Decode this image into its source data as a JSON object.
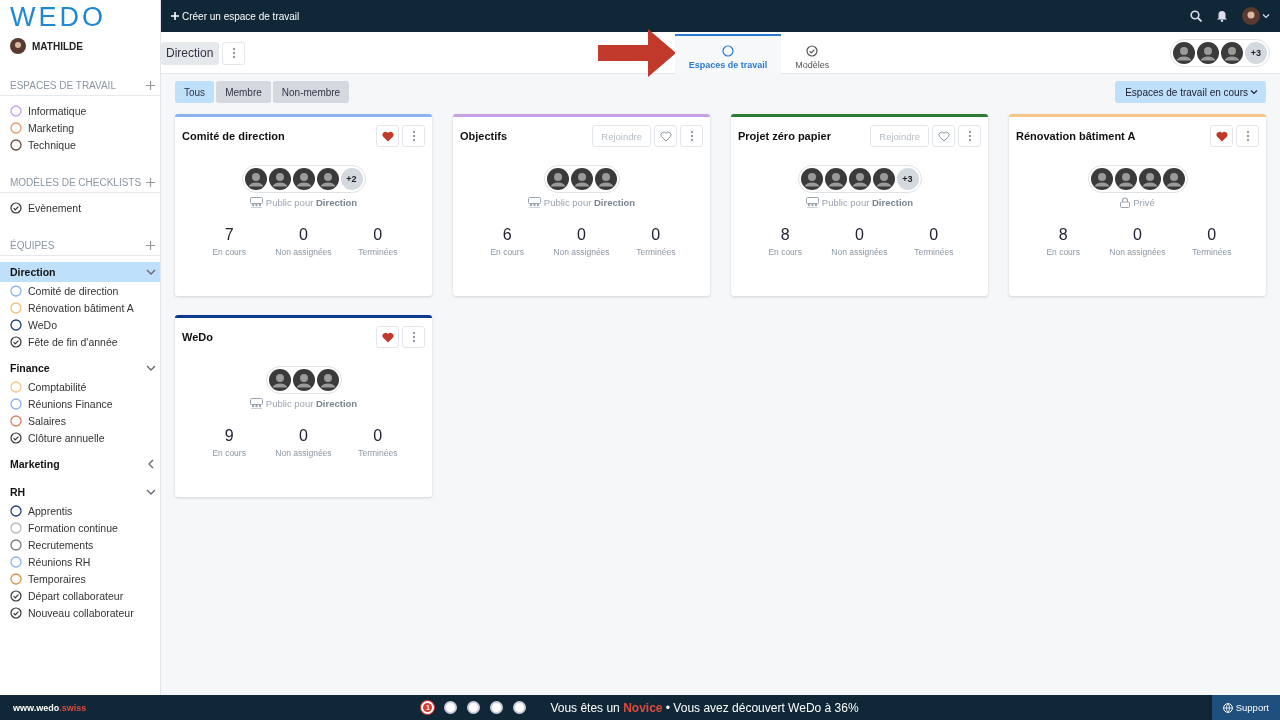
{
  "logo": "WEDO",
  "user": {
    "name": "MATHILDE"
  },
  "sidebar": {
    "sections": [
      {
        "title": "ESPACES DE TRAVAIL",
        "items": [
          {
            "label": "Informatique",
            "kind": "circle",
            "color": "#c9a0e6"
          },
          {
            "label": "Marketing",
            "kind": "circle",
            "color": "#e39a6e"
          },
          {
            "label": "Technique",
            "kind": "circle",
            "color": "#6b4a3a"
          }
        ]
      },
      {
        "title": "MODÈLES DE CHECKLISTS",
        "items": [
          {
            "label": "Evènement",
            "kind": "check"
          }
        ]
      },
      {
        "title": "ÉQUIPES",
        "teams": [
          {
            "name": "Direction",
            "expanded": true,
            "selected": true,
            "items": [
              {
                "label": "Comité de direction",
                "kind": "circle",
                "color": "#8ab4f0"
              },
              {
                "label": "Rénovation bâtiment A",
                "kind": "circle",
                "color": "#f5c07a"
              },
              {
                "label": "WeDo",
                "kind": "circle",
                "color": "#1f3f7a"
              },
              {
                "label": "Fête de fin d'année",
                "kind": "check"
              }
            ]
          },
          {
            "name": "Finance",
            "expanded": true,
            "selected": false,
            "items": [
              {
                "label": "Comptabilité",
                "kind": "circle",
                "color": "#f5c58a"
              },
              {
                "label": "Réunions Finance",
                "kind": "circle",
                "color": "#8ab4f0"
              },
              {
                "label": "Salaires",
                "kind": "circle",
                "color": "#d98060"
              },
              {
                "label": "Clôture annuelle",
                "kind": "check"
              }
            ]
          },
          {
            "name": "Marketing",
            "expanded": false,
            "selected": false
          },
          {
            "name": "RH",
            "expanded": true,
            "selected": false,
            "items": [
              {
                "label": "Apprentis",
                "kind": "circle",
                "color": "#1f3f7a"
              },
              {
                "label": "Formation continue",
                "kind": "circle",
                "color": "#b8b8b8"
              },
              {
                "label": "Recrutements",
                "kind": "circle",
                "color": "#7a7a7a"
              },
              {
                "label": "Réunions RH",
                "kind": "circle",
                "color": "#8ab4f0"
              },
              {
                "label": "Temporaires",
                "kind": "circle",
                "color": "#d4954a"
              },
              {
                "label": "Départ collaborateur",
                "kind": "check"
              },
              {
                "label": "Nouveau collaborateur",
                "kind": "check"
              }
            ]
          }
        ]
      }
    ]
  },
  "topbar": {
    "create_label": "Créer un espace de travail"
  },
  "subheader": {
    "team": "Direction",
    "tabs": [
      {
        "label": "Espaces de travail",
        "kind": "circle",
        "selected": true
      },
      {
        "label": "Modèles",
        "kind": "check",
        "selected": false
      }
    ],
    "member_avatars": [
      {
        "kind": "photo"
      },
      {
        "kind": "photo"
      },
      {
        "kind": "photo"
      }
    ],
    "member_more": "+3"
  },
  "filters": [
    {
      "label": "Tous",
      "selected": true
    },
    {
      "label": "Membre",
      "selected": false
    },
    {
      "label": "Non-membre",
      "selected": false
    }
  ],
  "status_dropdown": "Espaces de travail en cours",
  "cards": [
    {
      "title": "Comité de direction",
      "color": "#8ab4f0",
      "favorite": true,
      "avatars": [
        {
          "kind": "photo"
        },
        {
          "kind": "photo"
        },
        {
          "kind": "photo"
        },
        {
          "kind": "photo"
        }
      ],
      "more": "+2",
      "kind": "public",
      "visibility_text": "Public pour **Direction**",
      "stats": [
        {
          "value": "7",
          "label": "En cours"
        },
        {
          "value": "0",
          "label": "Non assignées"
        },
        {
          "value": "0",
          "label": "Terminées"
        }
      ]
    },
    {
      "title": "Objectifs",
      "color": "#c9a0e6",
      "favorite": false,
      "join": "Rejoindre",
      "avatars": [
        {
          "kind": "photo"
        },
        {
          "kind": "photo"
        },
        {
          "kind": "photo"
        }
      ],
      "kind": "public",
      "visibility_text": "Public pour **Direction**",
      "stats": [
        {
          "value": "6",
          "label": "En cours"
        },
        {
          "value": "0",
          "label": "Non assignées"
        },
        {
          "value": "0",
          "label": "Terminées"
        }
      ]
    },
    {
      "title": "Projet zéro papier",
      "color": "#2e7d32",
      "favorite": false,
      "join": "Rejoindre",
      "avatars": [
        {
          "kind": "photo"
        },
        {
          "kind": "photo"
        },
        {
          "kind": "photo"
        },
        {
          "kind": "photo"
        }
      ],
      "more": "+3",
      "kind": "public",
      "visibility_text": "Public pour **Direction**",
      "stats": [
        {
          "value": "8",
          "label": "En cours"
        },
        {
          "value": "0",
          "label": "Non assignées"
        },
        {
          "value": "0",
          "label": "Terminées"
        }
      ]
    },
    {
      "title": "Rénovation bâtiment A",
      "color": "#f5c58a",
      "favorite": true,
      "avatars": [
        {
          "kind": "photo"
        },
        {
          "kind": "photo"
        },
        {
          "kind": "photo"
        },
        {
          "kind": "photo"
        }
      ],
      "kind": "private",
      "visibility_text": "Privé",
      "stats": [
        {
          "value": "8",
          "label": "En cours"
        },
        {
          "value": "0",
          "label": "Non assignées"
        },
        {
          "value": "0",
          "label": "Terminées"
        }
      ]
    },
    {
      "title": "WeDo",
      "color": "#0d3a8c",
      "favorite": true,
      "avatars": [
        {
          "kind": "photo"
        },
        {
          "kind": "photo"
        },
        {
          "kind": "photo"
        }
      ],
      "kind": "public",
      "visibility_text": "Public pour **Direction**",
      "stats": [
        {
          "value": "9",
          "label": "En cours"
        },
        {
          "value": "0",
          "label": "Non assignées"
        },
        {
          "value": "0",
          "label": "Terminées"
        }
      ]
    }
  ],
  "footer": {
    "site": "www.wedo",
    "site_domain": ".swiss",
    "steps": [
      {
        "label": "1",
        "selected": true
      },
      {
        "selected": false
      },
      {
        "selected": false
      },
      {
        "selected": false
      },
      {
        "selected": false
      }
    ],
    "message": "Vous êtes un **Novice** • Vous avez découvert WeDo à 36%",
    "support": "Support"
  }
}
